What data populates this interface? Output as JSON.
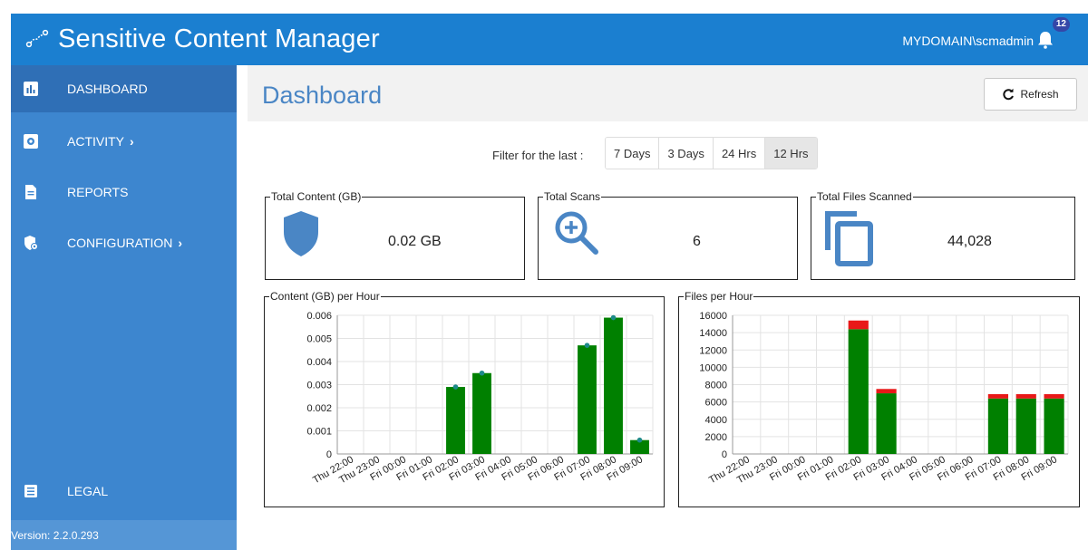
{
  "header": {
    "app_title": "Sensitive Content Manager",
    "user": "MYDOMAIN\\scmadmin",
    "notification_count": "12"
  },
  "sidebar": {
    "items": [
      {
        "label": "DASHBOARD",
        "icon": "bar-chart-icon",
        "active": true,
        "chevron": ""
      },
      {
        "label": "ACTIVITY",
        "icon": "gear-icon",
        "active": false,
        "chevron": "›"
      },
      {
        "label": "REPORTS",
        "icon": "document-icon",
        "active": false,
        "chevron": ""
      },
      {
        "label": "CONFIGURATION",
        "icon": "shield-gear-icon",
        "active": false,
        "chevron": "›"
      }
    ],
    "legal_label": "LEGAL",
    "version": "Version: 2.2.0.293"
  },
  "main": {
    "page_title": "Dashboard",
    "refresh_label": "Refresh",
    "filter_label": "Filter for the last :",
    "filter_options": [
      "7 Days",
      "3 Days",
      "24 Hrs",
      "12 Hrs"
    ],
    "filter_selected": "12 Hrs"
  },
  "stats": {
    "total_content": {
      "label": "Total Content (GB)",
      "value": "0.02 GB",
      "icon": "shield-icon"
    },
    "total_scans": {
      "label": "Total Scans",
      "value": "6",
      "icon": "magnify-plus-icon"
    },
    "total_files": {
      "label": "Total Files Scanned",
      "value": "44,028",
      "icon": "copy-files-icon"
    }
  },
  "colors": {
    "header": "#1b7fd0",
    "sidebar": "#3d86cf",
    "accent": "#4a86c5",
    "bar_green": "#008000",
    "bar_red": "#e81818",
    "point_teal": "#1e8a8a"
  },
  "chart_data": [
    {
      "type": "bar",
      "title": "Content (GB) per Hour",
      "categories": [
        "Thu 22:00",
        "Thu 23:00",
        "Fri 00:00",
        "Fri 01:00",
        "Fri 02:00",
        "Fri 03:00",
        "Fri 04:00",
        "Fri 05:00",
        "Fri 06:00",
        "Fri 07:00",
        "Fri 08:00",
        "Fri 09:00"
      ],
      "values": [
        0,
        0,
        0,
        0,
        0.0029,
        0.0035,
        0,
        0,
        0,
        0.0047,
        0.0059,
        0.0006
      ],
      "ylim": [
        0,
        0.006
      ],
      "yticks": [
        "0",
        "0.001",
        "0.002",
        "0.003",
        "0.004",
        "0.005",
        "0.006"
      ],
      "grid": true
    },
    {
      "type": "bar",
      "title": "Files per Hour",
      "categories": [
        "Thu 22:00",
        "Thu 23:00",
        "Fri 00:00",
        "Fri 01:00",
        "Fri 02:00",
        "Fri 03:00",
        "Fri 04:00",
        "Fri 05:00",
        "Fri 06:00",
        "Fri 07:00",
        "Fri 08:00",
        "Fri 09:00"
      ],
      "series": [
        {
          "values": [
            0,
            0,
            0,
            0,
            14400,
            7000,
            0,
            0,
            0,
            6400,
            6400,
            6400
          ]
        },
        {
          "values": [
            0,
            0,
            0,
            0,
            1000,
            500,
            0,
            0,
            0,
            500,
            500,
            500
          ]
        }
      ],
      "stacked": true,
      "ylim": [
        0,
        16000
      ],
      "yticks": [
        "0",
        "2000",
        "4000",
        "6000",
        "8000",
        "10000",
        "12000",
        "14000",
        "16000"
      ],
      "grid": true
    }
  ]
}
